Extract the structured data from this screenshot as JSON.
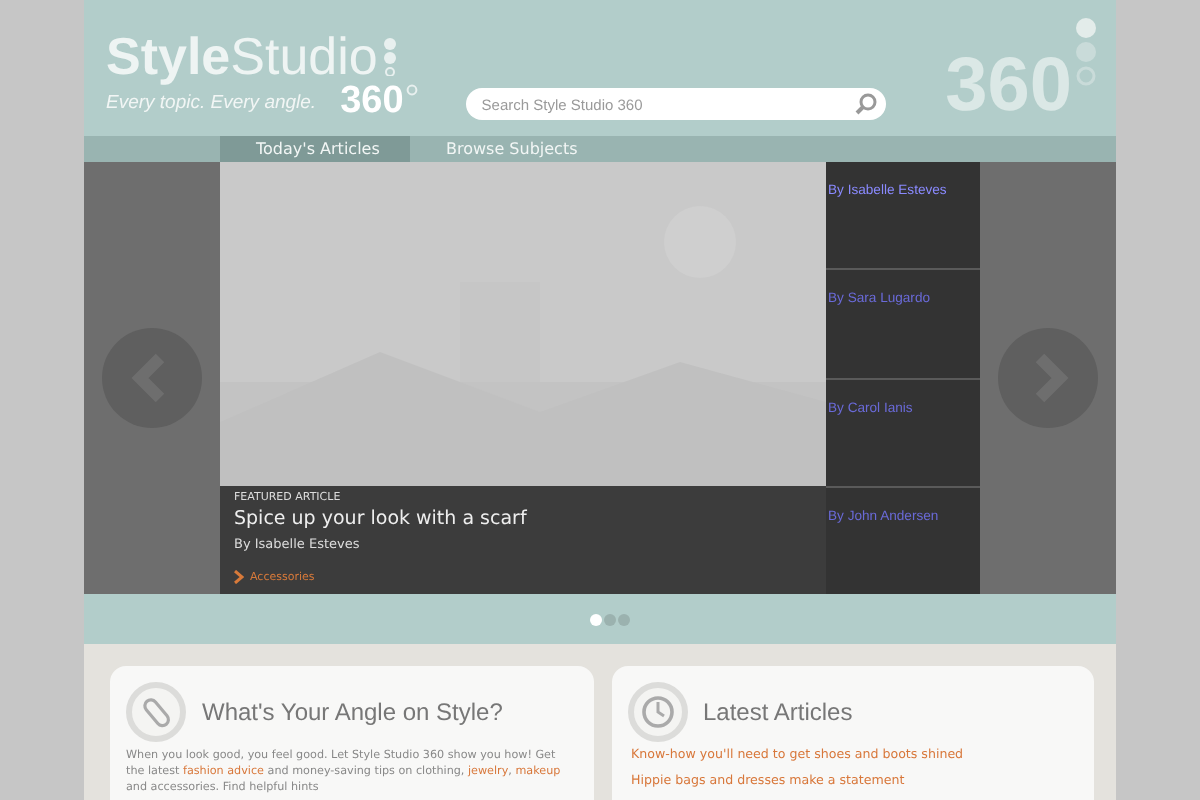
{
  "header": {
    "logo": "**Style**Studio",
    "logo_number": "360",
    "tagline": "Every topic. Every angle.",
    "watermark": "360",
    "search": {
      "placeholder": "Search Style Studio 360"
    }
  },
  "nav": {
    "tabs": [
      {
        "label": "Today's Articles",
        "selected": true
      },
      {
        "label": "Browse Subjects",
        "selected": false
      }
    ]
  },
  "slider": {
    "featured": {
      "eyebrow": "FEATURED ARTICLE",
      "title": "Spice up your look with a scarf",
      "byline": "By Isabelle Esteves",
      "category": "Accessories"
    },
    "side_items": [
      {
        "label": "By Isabelle Esteves",
        "selected": true
      },
      {
        "label": "By Sara Lugardo",
        "selected": false
      },
      {
        "label": "By Carol Ianis",
        "selected": false
      },
      {
        "label": "By John Andersen",
        "selected": false
      }
    ],
    "dots": [
      {
        "selected": true
      },
      {
        "selected": false
      },
      {
        "selected": false
      }
    ]
  },
  "cards": [
    {
      "kind": "about",
      "title": "What's Your Angle on Style?",
      "paragraph": [
        {
          "text": "When you look good, you feel good. Let Style Studio 360 show you how! Get the latest ",
          "link": false
        },
        {
          "text": "fashion advice",
          "link": true
        },
        {
          "text": " and money-saving tips on clothing, ",
          "link": false
        },
        {
          "text": "jewelry",
          "link": true
        },
        {
          "text": ", ",
          "link": false
        },
        {
          "text": "makeup",
          "link": true
        },
        {
          "text": " and accessories. Find helpful hints",
          "link": false
        }
      ]
    },
    {
      "kind": "latest",
      "title": "Latest Articles",
      "links": [
        "Know-how you'll need to get shoes and boots shined",
        "Hippie bags and dresses make a statement"
      ]
    }
  ]
}
